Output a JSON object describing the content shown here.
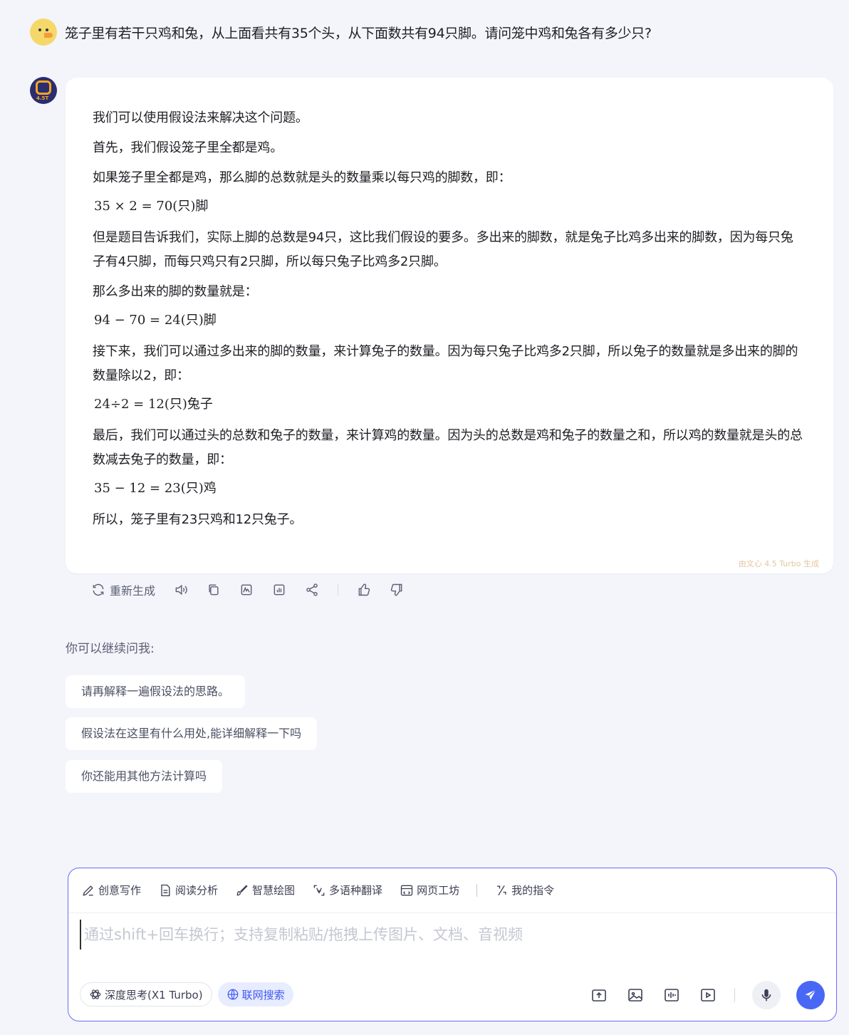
{
  "user_message": "笼子里有若干只鸡和兔，从上面看共有35个头，从下面数共有94只脚。请问笼中鸡和兔各有多少只?",
  "bot_avatar": {
    "version_badge": "4.5T"
  },
  "answer": {
    "p1": "我们可以使用假设法来解决这个问题。",
    "p2": "首先，我们假设笼子里全都是鸡。",
    "p3": "如果笼子里全都是鸡，那么脚的总数就是头的数量乘以每只鸡的脚数，即：",
    "f1": "35 × 2 = 70(只)脚",
    "p4": "但是题目告诉我们，实际上脚的总数是94只，这比我们假设的要多。多出来的脚数，就是兔子比鸡多出来的脚数，因为每只兔子有4只脚，而每只鸡只有2只脚，所以每只兔子比鸡多2只脚。",
    "p5": "那么多出来的脚的数量就是：",
    "f2": "94 − 70 = 24(只)脚",
    "p6": "接下来，我们可以通过多出来的脚的数量，来计算兔子的数量。因为每只兔子比鸡多2只脚，所以兔子的数量就是多出来的脚的数量除以2，即：",
    "f3": "24÷2 = 12(只)兔子",
    "p7": "最后，我们可以通过头的总数和兔子的数量，来计算鸡的数量。因为头的总数是鸡和兔子的数量之和，所以鸡的数量就是头的总数减去兔子的数量，即：",
    "f4": "35 − 12 = 23(只)鸡",
    "p8": "所以，笼子里有23只鸡和12只兔子。",
    "watermark": "由文心 4.5 Turbo 生成"
  },
  "actions": {
    "regenerate_label": "重新生成"
  },
  "suggestions": {
    "title": "你可以继续问我:",
    "items": [
      "请再解释一遍假设法的思路。",
      "假设法在这里有什么用处,能详细解释一下吗",
      "你还能用其他方法计算吗"
    ]
  },
  "input": {
    "tools": [
      "创意写作",
      "阅读分析",
      "智慧绘图",
      "多语种翻译",
      "网页工坊",
      "我的指令"
    ],
    "placeholder": "通过shift+回车换行；支持复制粘贴/拖拽上传图片、文档、音视频",
    "deep_think_label": "深度思考(X1 Turbo)",
    "web_search_label": "联网搜索"
  },
  "colors": {
    "accent": "#4867f5",
    "border": "#6a6cf2",
    "background": "#f4f5fb"
  }
}
